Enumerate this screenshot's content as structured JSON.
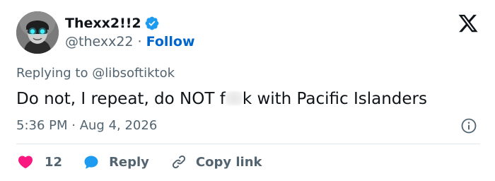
{
  "author": {
    "display_name": "Thexx2!!2",
    "handle": "@thexx22",
    "separator": " · ",
    "follow_label": "Follow",
    "verified": true
  },
  "reply_context": {
    "prefix": "Replying to ",
    "mention": "@libsoftiktok"
  },
  "tweet": {
    "text_before": "Do not, I repeat, do NOT f",
    "text_after": "k with Pacific Islanders",
    "time": "5:36 PM",
    "separator": " · ",
    "date": "Aug 4, 2026"
  },
  "actions": {
    "like_count": "12",
    "reply_label": "Reply",
    "copy_label": "Copy link"
  },
  "colors": {
    "accent": "#0066cc",
    "like": "#f91880",
    "reply": "#1d9bf0",
    "muted": "#536471",
    "text": "#0f1419"
  },
  "icons": [
    "avatar",
    "verified-badge-icon",
    "x-logo-icon",
    "info-icon",
    "heart-icon",
    "reply-bubble-icon",
    "link-icon"
  ]
}
